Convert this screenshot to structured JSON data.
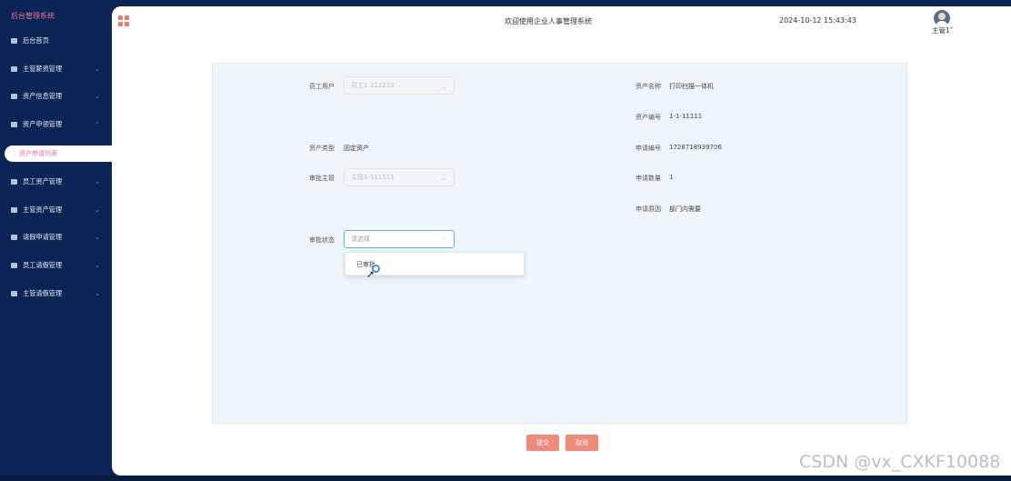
{
  "sidebar": {
    "brand": "后台管理系统",
    "items": [
      {
        "label": "后台首页"
      },
      {
        "label": "主管薪资管理"
      },
      {
        "label": "资产信息管理"
      },
      {
        "label": "资产申领管理"
      },
      {
        "label": "员工资产管理"
      },
      {
        "label": "主管资产管理"
      },
      {
        "label": "请假申请管理"
      },
      {
        "label": "员工请假管理"
      },
      {
        "label": "主管请假管理"
      }
    ],
    "submenu_active": "资产申请列表"
  },
  "header": {
    "title": "欢迎使用企业人事管理系统",
    "datetime": "2024-10-12 15:43:43",
    "user": "主管1"
  },
  "form": {
    "employee_label": "员工用户",
    "employee_value": "员工1-222222",
    "asset_type_label": "资产类型",
    "asset_type_value": "固定资产",
    "approver_label": "审批主管",
    "approver_value": "主管1-111111",
    "status_label": "审批状态",
    "status_placeholder": "请选择",
    "status_option": "已审批",
    "asset_name_label": "资产名称",
    "asset_name_value": "打印扫描一体机",
    "asset_no_label": "资产编号",
    "asset_no_value": "1-1-11111",
    "apply_no_label": "申请编号",
    "apply_no_value": "1728718939706",
    "apply_qty_label": "申请数量",
    "apply_qty_value": "1",
    "apply_reason_label": "申请原因",
    "apply_reason_value": "部门内需要"
  },
  "actions": {
    "submit": "提交",
    "cancel": "取消"
  },
  "watermark": "CSDN @vx_CXKF10088"
}
